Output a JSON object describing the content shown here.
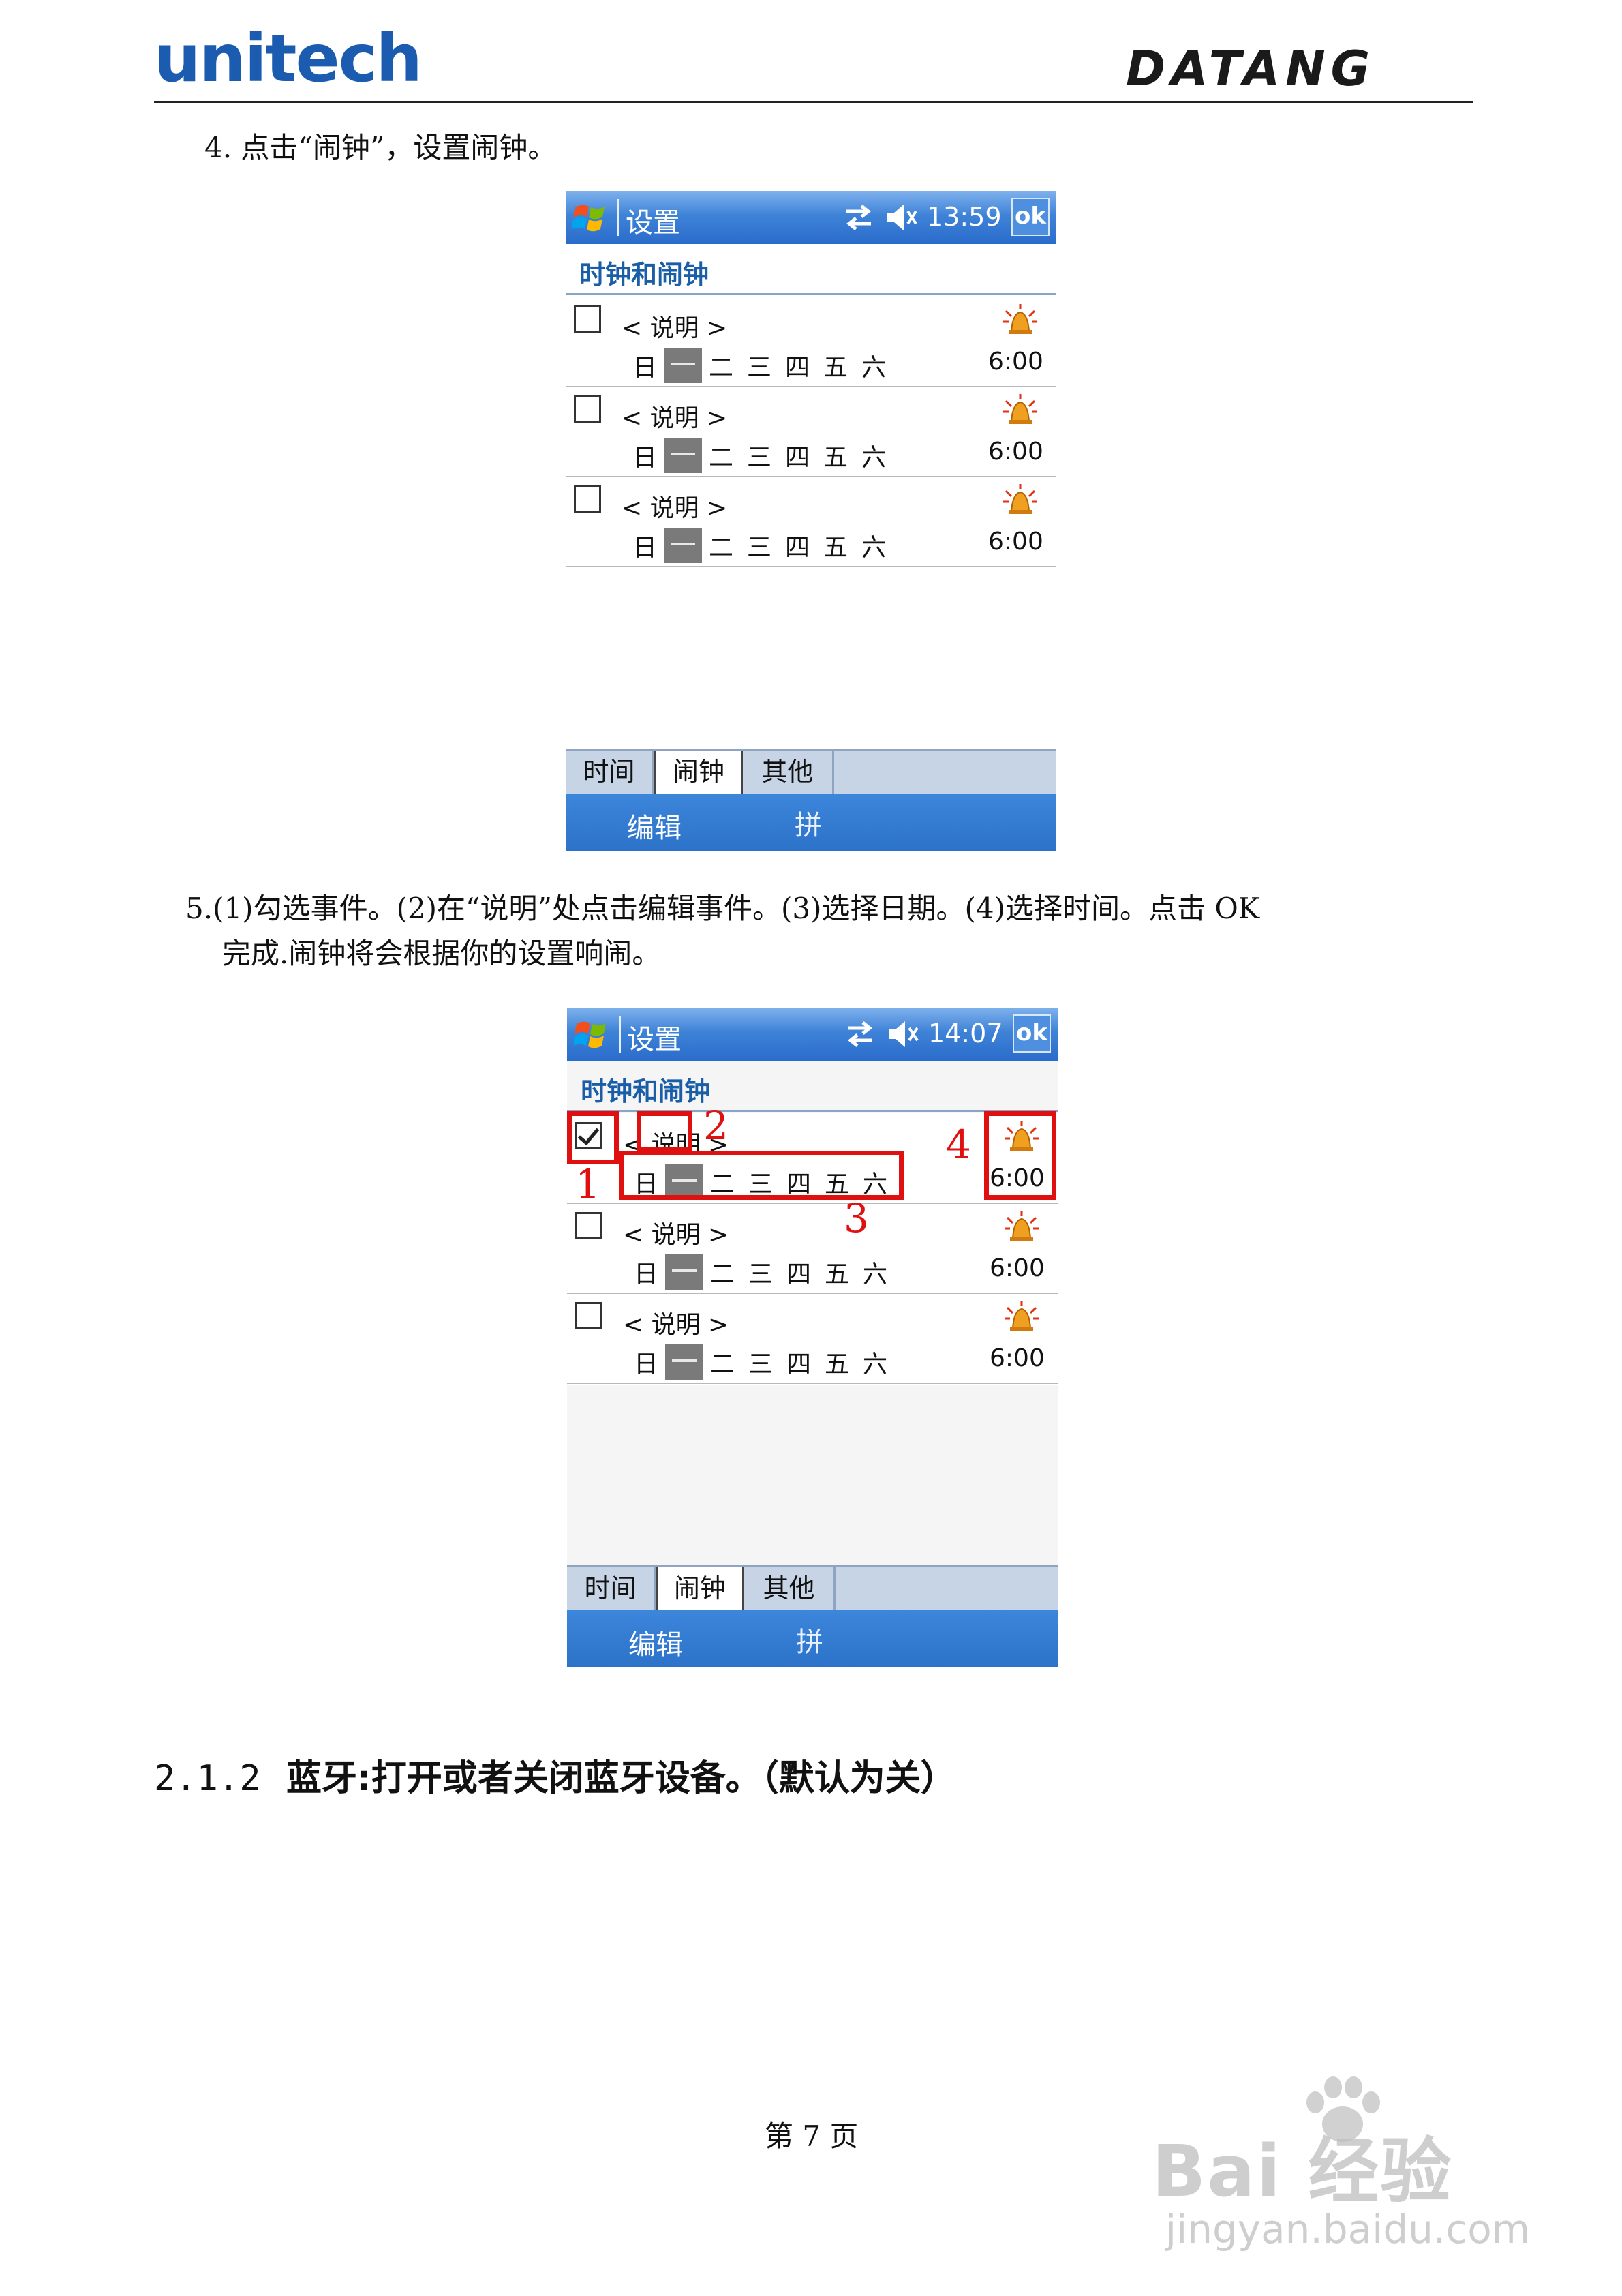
{
  "header": {
    "brand_left": "unitech",
    "brand_right": "DATANG"
  },
  "steps": {
    "step4": "4. 点击“闹钟”，设置闹钟。",
    "step5_line1": "5.(1)勾选事件。(2)在“说明”处点击编辑事件。(3)选择日期。(4)选择时间。点击 OK",
    "step5_line2": "完成.闹钟将会根据你的设置响闹。"
  },
  "screen1": {
    "title": "设置",
    "clock": "13:59",
    "ok": "ok",
    "subtitle": "时钟和闹钟",
    "alarms": [
      {
        "description": "< 说明 >",
        "days": [
          "日",
          "一",
          "二",
          "三",
          "四",
          "五",
          "六"
        ],
        "selected_day": "一",
        "time": "6:00",
        "checked": false
      },
      {
        "description": "< 说明 >",
        "days": [
          "日",
          "一",
          "二",
          "三",
          "四",
          "五",
          "六"
        ],
        "selected_day": "一",
        "time": "6:00",
        "checked": false
      },
      {
        "description": "< 说明 >",
        "days": [
          "日",
          "一",
          "二",
          "三",
          "四",
          "五",
          "六"
        ],
        "selected_day": "一",
        "time": "6:00",
        "checked": false
      }
    ],
    "tabs": [
      "时间",
      "闹钟",
      "其他"
    ],
    "active_tab": "闹钟",
    "softkey_left": "编辑",
    "softkey_right": "拼"
  },
  "screen2": {
    "title": "设置",
    "clock": "14:07",
    "ok": "ok",
    "subtitle": "时钟和闹钟",
    "alarms": [
      {
        "description": "< 说明 >",
        "days": [
          "日",
          "一",
          "二",
          "三",
          "四",
          "五",
          "六"
        ],
        "selected_day": "一",
        "time": "6:00",
        "checked": true
      },
      {
        "description": "< 说明 >",
        "days": [
          "日",
          "一",
          "二",
          "三",
          "四",
          "五",
          "六"
        ],
        "selected_day": "一",
        "time": "6:00",
        "checked": false
      },
      {
        "description": "< 说明 >",
        "days": [
          "日",
          "一",
          "二",
          "三",
          "四",
          "五",
          "六"
        ],
        "selected_day": "一",
        "time": "6:00",
        "checked": false
      }
    ],
    "tabs": [
      "时间",
      "闹钟",
      "其他"
    ],
    "active_tab": "闹钟",
    "softkey_left": "编辑",
    "softkey_right": "拼",
    "callout_numbers": [
      "1",
      "2",
      "3",
      "4"
    ],
    "callout_color": "#e01010"
  },
  "section": {
    "number": "2.1.2",
    "title": "蓝牙:打开或者关闭蓝牙设备。（默认为关）"
  },
  "footer": {
    "page": "第 7 页"
  },
  "watermark": {
    "main": "Bai 经验",
    "sub": "jingyan.baidu.com"
  },
  "colors": {
    "titlebar": "#3f83d8",
    "softbar": "#2c72c9",
    "brand_blue": "#1c5cb0",
    "callout": "#e01010"
  }
}
